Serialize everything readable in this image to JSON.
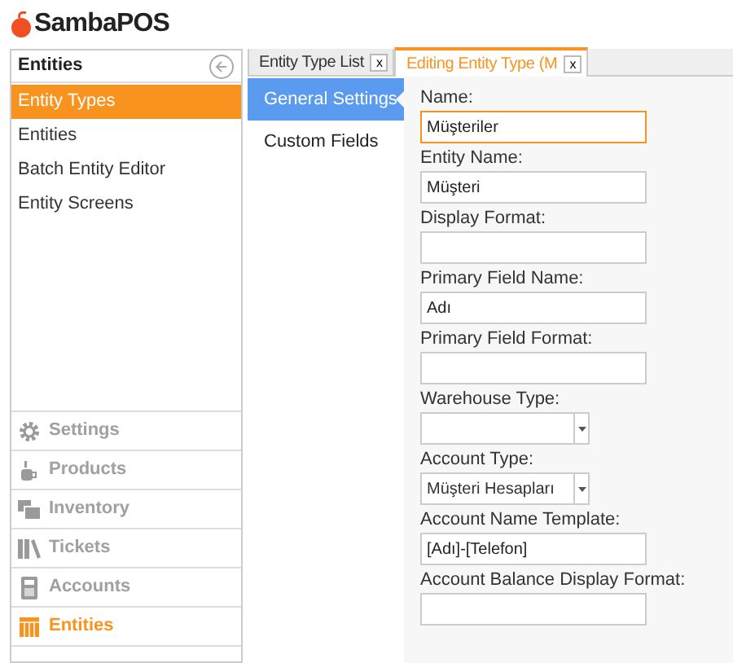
{
  "logo": {
    "text": "SambaPOS"
  },
  "sidebar": {
    "title": "Entities",
    "items": [
      {
        "label": "Entity Types",
        "selected": true
      },
      {
        "label": "Entities",
        "selected": false
      },
      {
        "label": "Batch Entity Editor",
        "selected": false
      },
      {
        "label": "Entity Screens",
        "selected": false
      }
    ]
  },
  "nav": [
    {
      "label": "Settings",
      "kind": "gear",
      "selected": false
    },
    {
      "label": "Products",
      "kind": "cup",
      "selected": false
    },
    {
      "label": "Inventory",
      "kind": "boxes",
      "selected": false
    },
    {
      "label": "Tickets",
      "kind": "books",
      "selected": false
    },
    {
      "label": "Accounts",
      "kind": "calculator",
      "selected": false
    },
    {
      "label": "Entities",
      "kind": "table",
      "selected": true
    }
  ],
  "tabs": [
    {
      "label": "Entity Type List",
      "close": "x",
      "selected": false
    },
    {
      "label": "Editing Entity Type (M",
      "close": "x",
      "selected": true
    }
  ],
  "sections": [
    {
      "label": "General Settings",
      "selected": true
    },
    {
      "label": "Custom Fields",
      "selected": false
    }
  ],
  "fields": [
    {
      "label": "Name:",
      "kind": "text",
      "value": "Müşteriler",
      "focused": true
    },
    {
      "label": "Entity Name:",
      "kind": "text",
      "value": "Müşteri",
      "focused": false
    },
    {
      "label": "Display Format:",
      "kind": "text",
      "focused": false
    },
    {
      "label": "Primary Field Name:",
      "kind": "text",
      "value": "Adı",
      "focused": false
    },
    {
      "label": "Primary Field Format:",
      "kind": "text",
      "focused": false
    },
    {
      "label": "Warehouse Type:",
      "kind": "dropdown",
      "focused": false
    },
    {
      "label": "Account Type:",
      "kind": "dropdown",
      "value": "Müşteri Hesapları",
      "focused": false
    },
    {
      "label": "Account Name Template:",
      "kind": "text",
      "value": "[Adı]-[Telefon]",
      "focused": false
    },
    {
      "label": "Account Balance Display Format:",
      "kind": "text",
      "focused": false
    }
  ]
}
